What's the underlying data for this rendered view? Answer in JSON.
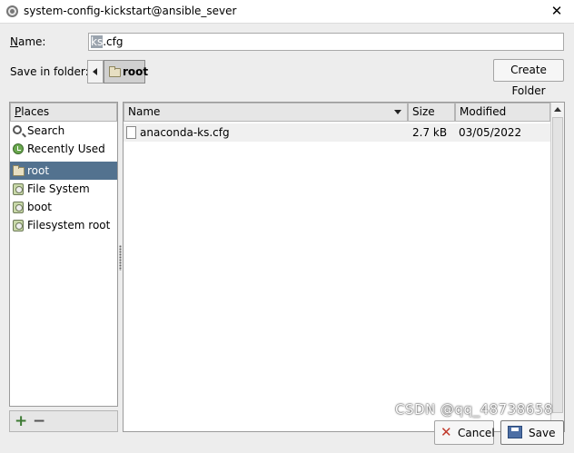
{
  "window": {
    "title": "system-config-kickstart@ansible_sever",
    "close_glyph": "✕"
  },
  "name_field": {
    "label": "Name:",
    "value_selected": "ks",
    "value_rest": ".cfg"
  },
  "folder": {
    "label": "Save in folder:",
    "path_button": "root",
    "create_folder": "Create Folder"
  },
  "places": {
    "header": "Places",
    "items": [
      {
        "label": "Search",
        "icon": "search-icon"
      },
      {
        "label": "Recently Used",
        "icon": "recent-icon"
      },
      {
        "label": "root",
        "icon": "folder-icon",
        "selected": true
      },
      {
        "label": "File System",
        "icon": "disk-icon"
      },
      {
        "label": "boot",
        "icon": "disk-icon"
      },
      {
        "label": "Filesystem root",
        "icon": "disk-icon"
      }
    ],
    "add_glyph": "+",
    "remove_glyph": "−"
  },
  "files": {
    "columns": [
      "Name",
      "Size",
      "Modified"
    ],
    "rows": [
      {
        "name": "anaconda-ks.cfg",
        "size": "2.7 kB",
        "modified": "03/05/2022"
      }
    ]
  },
  "buttons": {
    "cancel": "Cancel",
    "save": "Save",
    "cancel_glyph": "✕"
  },
  "watermark": "CSDN @qq_48738658",
  "colors": {
    "selection": "#53728f",
    "dialog_bg": "#ededed"
  }
}
